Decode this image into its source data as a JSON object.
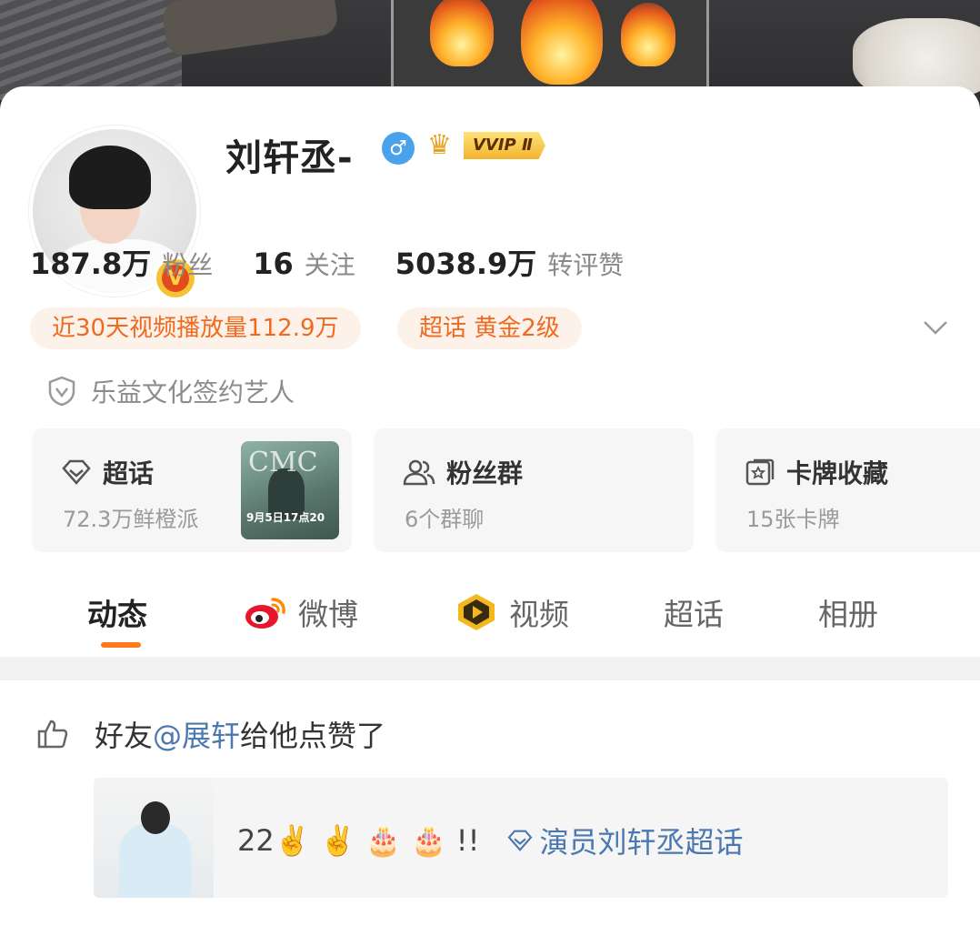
{
  "profile": {
    "name": "刘轩丞-",
    "gender_icon": "♂",
    "vip_label": "VVIP Ⅱ",
    "verified_badge": "V"
  },
  "stats": [
    {
      "value": "187.8万",
      "label": "粉丝"
    },
    {
      "value": "16",
      "label": "关注"
    },
    {
      "value": "5038.9万",
      "label": "转评赞"
    }
  ],
  "pills": {
    "views": "近30天视频播放量112.9万",
    "chaohua_level": "超话 黄金2级"
  },
  "signed": "乐益文化签约艺人",
  "tiles": [
    {
      "title": "超话",
      "sub": "72.3万鲜橙派",
      "icon": "diamond-icon"
    },
    {
      "title": "粉丝群",
      "sub": "6个群聊",
      "icon": "group-icon"
    },
    {
      "title": "卡牌收藏",
      "sub": "15张卡牌",
      "icon": "card-icon"
    }
  ],
  "tile_thumb": {
    "logo_text": "CMC",
    "date_text": "9月5日17点20"
  },
  "tabs": [
    "动态",
    "微博",
    "视频",
    "超话",
    "相册"
  ],
  "feed": {
    "prefix": "好友",
    "mention": "@展轩",
    "suffix": "给他点赞了",
    "post_text": "22✌️ ✌️ 🎂 🎂 !!",
    "post_topic": "演员刘轩丞超话"
  },
  "colors": {
    "accent": "#ff7a1a",
    "link": "#4b78b0",
    "pill_bg": "#fdf2ea",
    "pill_text": "#ef6a1f"
  }
}
